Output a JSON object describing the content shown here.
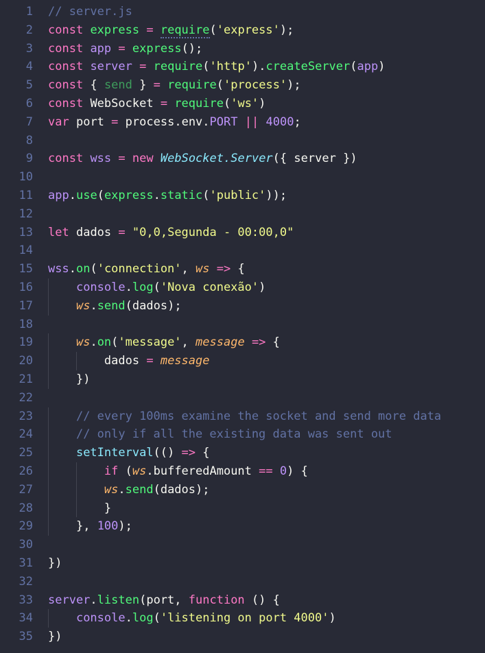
{
  "editor": {
    "filename": "server.js",
    "language": "javascript",
    "theme": "dracula",
    "background_color": "#282a36",
    "gutter_color": "#6272a4",
    "indent_guide_color": "#424450",
    "total_lines": 35,
    "first_visible_line": 1,
    "colors": {
      "keyword": "#ff79c6",
      "function": "#50fa7b",
      "variable": "#bd93f9",
      "string": "#f1fa8c",
      "comment": "#6272a4",
      "plain": "#f8f8f2",
      "class": "#8be9fd",
      "parameter": "#ffb86c",
      "number": "#bd93f9"
    }
  },
  "lines": [
    {
      "n": "1",
      "text": "// server.js"
    },
    {
      "n": "2",
      "text": "const express = require('express');"
    },
    {
      "n": "3",
      "text": "const app = express();"
    },
    {
      "n": "4",
      "text": "const server = require('http').createServer(app)"
    },
    {
      "n": "5",
      "text": "const { send } = require('process');"
    },
    {
      "n": "6",
      "text": "const WebSocket = require('ws')"
    },
    {
      "n": "7",
      "text": "var port = process.env.PORT || 4000;"
    },
    {
      "n": "8",
      "text": ""
    },
    {
      "n": "9",
      "text": "const wss = new WebSocket.Server({ server })"
    },
    {
      "n": "10",
      "text": ""
    },
    {
      "n": "11",
      "text": "app.use(express.static('public'));"
    },
    {
      "n": "12",
      "text": ""
    },
    {
      "n": "13",
      "text": "let dados = \"0,0,Segunda - 00:00,0\""
    },
    {
      "n": "14",
      "text": ""
    },
    {
      "n": "15",
      "text": "wss.on('connection', ws => {"
    },
    {
      "n": "16",
      "text": "    console.log('Nova conexão')"
    },
    {
      "n": "17",
      "text": "    ws.send(dados);"
    },
    {
      "n": "18",
      "text": ""
    },
    {
      "n": "19",
      "text": "    ws.on('message', message => {"
    },
    {
      "n": "20",
      "text": "        dados = message"
    },
    {
      "n": "21",
      "text": "    })"
    },
    {
      "n": "22",
      "text": ""
    },
    {
      "n": "23",
      "text": "    // every 100ms examine the socket and send more data"
    },
    {
      "n": "24",
      "text": "    // only if all the existing data was sent out"
    },
    {
      "n": "25",
      "text": "    setInterval(() => {"
    },
    {
      "n": "26",
      "text": "        if (ws.bufferedAmount == 0) {"
    },
    {
      "n": "27",
      "text": "        ws.send(dados);"
    },
    {
      "n": "28",
      "text": "        }"
    },
    {
      "n": "29",
      "text": "    }, 100);"
    },
    {
      "n": "30",
      "text": ""
    },
    {
      "n": "31",
      "text": "})"
    },
    {
      "n": "32",
      "text": ""
    },
    {
      "n": "33",
      "text": "server.listen(port, function () {"
    },
    {
      "n": "34",
      "text": "    console.log('listening on port 4000')"
    },
    {
      "n": "35",
      "text": "})"
    }
  ],
  "tokens": {
    "l1": [
      [
        "// server.js",
        "cmt"
      ]
    ],
    "l2": [
      [
        "const",
        "kw"
      ],
      [
        " ",
        ""
      ],
      [
        "express",
        "fn"
      ],
      [
        " ",
        ""
      ],
      [
        "=",
        "op"
      ],
      [
        " ",
        ""
      ],
      [
        "require",
        "fn-squig"
      ],
      [
        "(",
        "pln"
      ],
      [
        "'express'",
        "str"
      ],
      [
        ")",
        "pln"
      ],
      [
        ";",
        "pln"
      ]
    ],
    "l3": [
      [
        "const",
        "kw"
      ],
      [
        " ",
        ""
      ],
      [
        "app",
        "var"
      ],
      [
        " ",
        ""
      ],
      [
        "=",
        "op"
      ],
      [
        " ",
        ""
      ],
      [
        "express",
        "fn"
      ],
      [
        "()",
        "pln"
      ],
      [
        ";",
        "pln"
      ]
    ],
    "l4": [
      [
        "const",
        "kw"
      ],
      [
        " ",
        ""
      ],
      [
        "server",
        "var"
      ],
      [
        " ",
        ""
      ],
      [
        "=",
        "op"
      ],
      [
        " ",
        ""
      ],
      [
        "require",
        "fn"
      ],
      [
        "(",
        "pln"
      ],
      [
        "'http'",
        "str"
      ],
      [
        ")",
        "pln"
      ],
      [
        ".",
        "pln"
      ],
      [
        "createServer",
        "fn"
      ],
      [
        "(",
        "pln"
      ],
      [
        "app",
        "var"
      ],
      [
        ")",
        "pln"
      ]
    ],
    "l5": [
      [
        "const",
        "kw"
      ],
      [
        " ",
        ""
      ],
      [
        "{",
        "pln"
      ],
      [
        " ",
        ""
      ],
      [
        "send",
        "dim"
      ],
      [
        " ",
        ""
      ],
      [
        "}",
        "pln"
      ],
      [
        " ",
        ""
      ],
      [
        "=",
        "op"
      ],
      [
        " ",
        ""
      ],
      [
        "require",
        "fn"
      ],
      [
        "(",
        "pln"
      ],
      [
        "'process'",
        "str"
      ],
      [
        ")",
        "pln"
      ],
      [
        ";",
        "pln"
      ]
    ],
    "l6": [
      [
        "const",
        "kw"
      ],
      [
        " ",
        ""
      ],
      [
        "WebSocket",
        "pln"
      ],
      [
        " ",
        ""
      ],
      [
        "=",
        "op"
      ],
      [
        " ",
        ""
      ],
      [
        "require",
        "fn"
      ],
      [
        "(",
        "pln"
      ],
      [
        "'ws'",
        "str"
      ],
      [
        ")",
        "pln"
      ]
    ],
    "l7": [
      [
        "var",
        "kw"
      ],
      [
        " ",
        ""
      ],
      [
        "port",
        "pln"
      ],
      [
        " ",
        ""
      ],
      [
        "=",
        "op"
      ],
      [
        " ",
        ""
      ],
      [
        "process",
        "pln"
      ],
      [
        ".",
        "pln"
      ],
      [
        "env",
        "pln"
      ],
      [
        ".",
        "pln"
      ],
      [
        "PORT",
        "var"
      ],
      [
        " ",
        ""
      ],
      [
        "||",
        "op"
      ],
      [
        " ",
        ""
      ],
      [
        "4000",
        "num"
      ],
      [
        ";",
        "pln"
      ]
    ],
    "l9": [
      [
        "const",
        "kw"
      ],
      [
        " ",
        ""
      ],
      [
        "wss",
        "var"
      ],
      [
        " ",
        ""
      ],
      [
        "=",
        "op"
      ],
      [
        " ",
        ""
      ],
      [
        "new",
        "kw"
      ],
      [
        " ",
        ""
      ],
      [
        "WebSocket",
        "cls"
      ],
      [
        ".",
        "cls"
      ],
      [
        "Server",
        "cls"
      ],
      [
        "({",
        "pln"
      ],
      [
        " ",
        ""
      ],
      [
        "server",
        "pln"
      ],
      [
        " ",
        ""
      ],
      [
        "})",
        "pln"
      ]
    ],
    "l11": [
      [
        "app",
        "var"
      ],
      [
        ".",
        "pln"
      ],
      [
        "use",
        "fn"
      ],
      [
        "(",
        "pln"
      ],
      [
        "express",
        "fn"
      ],
      [
        ".",
        "pln"
      ],
      [
        "static",
        "fn"
      ],
      [
        "(",
        "pln"
      ],
      [
        "'public'",
        "str"
      ],
      [
        "))",
        "pln"
      ],
      [
        ";",
        "pln"
      ]
    ],
    "l13": [
      [
        "let",
        "kw"
      ],
      [
        " ",
        ""
      ],
      [
        "dados",
        "pln"
      ],
      [
        " ",
        ""
      ],
      [
        "=",
        "op"
      ],
      [
        " ",
        ""
      ],
      [
        "\"0,0,Segunda - 00:00,0\"",
        "str"
      ]
    ],
    "l15": [
      [
        "wss",
        "var"
      ],
      [
        ".",
        "pln"
      ],
      [
        "on",
        "fn"
      ],
      [
        "(",
        "pln"
      ],
      [
        "'connection'",
        "str"
      ],
      [
        ", ",
        "pln"
      ],
      [
        "ws",
        "prm"
      ],
      [
        " ",
        ""
      ],
      [
        "=>",
        "op"
      ],
      [
        " ",
        ""
      ],
      [
        "{",
        "pln"
      ]
    ],
    "l16": [
      [
        "    ",
        ""
      ],
      [
        "console",
        "var"
      ],
      [
        ".",
        "pln"
      ],
      [
        "log",
        "fn"
      ],
      [
        "(",
        "pln"
      ],
      [
        "'Nova conexão'",
        "str"
      ],
      [
        ")",
        "pln"
      ]
    ],
    "l17": [
      [
        "    ",
        ""
      ],
      [
        "ws",
        "prm"
      ],
      [
        ".",
        "pln"
      ],
      [
        "send",
        "fn"
      ],
      [
        "(",
        "pln"
      ],
      [
        "dados",
        "pln"
      ],
      [
        ")",
        "pln"
      ],
      [
        ";",
        "pln"
      ]
    ],
    "l19": [
      [
        "    ",
        ""
      ],
      [
        "ws",
        "prm"
      ],
      [
        ".",
        "pln"
      ],
      [
        "on",
        "fn"
      ],
      [
        "(",
        "pln"
      ],
      [
        "'message'",
        "str"
      ],
      [
        ", ",
        "pln"
      ],
      [
        "message",
        "prm"
      ],
      [
        " ",
        ""
      ],
      [
        "=>",
        "op"
      ],
      [
        " ",
        ""
      ],
      [
        "{",
        "pln"
      ]
    ],
    "l20": [
      [
        "        ",
        ""
      ],
      [
        "dados",
        "pln"
      ],
      [
        " ",
        ""
      ],
      [
        "=",
        "op"
      ],
      [
        " ",
        ""
      ],
      [
        "message",
        "prm"
      ]
    ],
    "l21": [
      [
        "    ",
        ""
      ],
      [
        "})",
        "pln"
      ]
    ],
    "l23": [
      [
        "    ",
        ""
      ],
      [
        "// every 100ms examine the socket and send more data",
        "cmt"
      ]
    ],
    "l24": [
      [
        "    ",
        ""
      ],
      [
        "// only if all the existing data was sent out",
        "cmt"
      ]
    ],
    "l25": [
      [
        "    ",
        ""
      ],
      [
        "setInterval",
        "teal"
      ],
      [
        "((",
        "pln"
      ],
      [
        ")",
        "pln"
      ],
      [
        " ",
        ""
      ],
      [
        "=>",
        "op"
      ],
      [
        " ",
        ""
      ],
      [
        "{",
        "pln"
      ]
    ],
    "l26": [
      [
        "        ",
        ""
      ],
      [
        "if",
        "kw"
      ],
      [
        " ",
        ""
      ],
      [
        "(",
        "pln"
      ],
      [
        "ws",
        "prm"
      ],
      [
        ".",
        "pln"
      ],
      [
        "bufferedAmount",
        "pln"
      ],
      [
        " ",
        ""
      ],
      [
        "==",
        "op"
      ],
      [
        " ",
        ""
      ],
      [
        "0",
        "num"
      ],
      [
        ")",
        "pln"
      ],
      [
        " ",
        ""
      ],
      [
        "{",
        "pln"
      ]
    ],
    "l27": [
      [
        "        ",
        ""
      ],
      [
        "ws",
        "prm"
      ],
      [
        ".",
        "pln"
      ],
      [
        "send",
        "fn"
      ],
      [
        "(",
        "pln"
      ],
      [
        "dados",
        "pln"
      ],
      [
        ")",
        "pln"
      ],
      [
        ";",
        "pln"
      ]
    ],
    "l28": [
      [
        "        ",
        ""
      ],
      [
        "}",
        "pln"
      ]
    ],
    "l29": [
      [
        "    ",
        ""
      ],
      [
        "}",
        "pln"
      ],
      [
        ", ",
        "pln"
      ],
      [
        "100",
        "num"
      ],
      [
        ")",
        "pln"
      ],
      [
        ";",
        "pln"
      ]
    ],
    "l31": [
      [
        "})",
        "pln"
      ]
    ],
    "l33": [
      [
        "server",
        "var"
      ],
      [
        ".",
        "pln"
      ],
      [
        "listen",
        "fn"
      ],
      [
        "(",
        "pln"
      ],
      [
        "port",
        "pln"
      ],
      [
        ", ",
        "pln"
      ],
      [
        "function",
        "kw"
      ],
      [
        " ",
        ""
      ],
      [
        "()",
        "pln"
      ],
      [
        " ",
        ""
      ],
      [
        "{",
        "pln"
      ]
    ],
    "l34": [
      [
        "    ",
        ""
      ],
      [
        "console",
        "var"
      ],
      [
        ".",
        "pln"
      ],
      [
        "log",
        "fn"
      ],
      [
        "(",
        "pln"
      ],
      [
        "'listening on port 4000'",
        "str"
      ],
      [
        ")",
        "pln"
      ]
    ],
    "l35": [
      [
        "})",
        "pln"
      ]
    ]
  },
  "guides": {
    "l16": 1,
    "l17": 1,
    "l18": 1,
    "l19": 1,
    "l20": 2,
    "l21": 1,
    "l22": 1,
    "l23": 1,
    "l24": 1,
    "l25": 1,
    "l26": 2,
    "l27": 2,
    "l28": 2,
    "l29": 1,
    "l30": 1,
    "l34": 1
  }
}
